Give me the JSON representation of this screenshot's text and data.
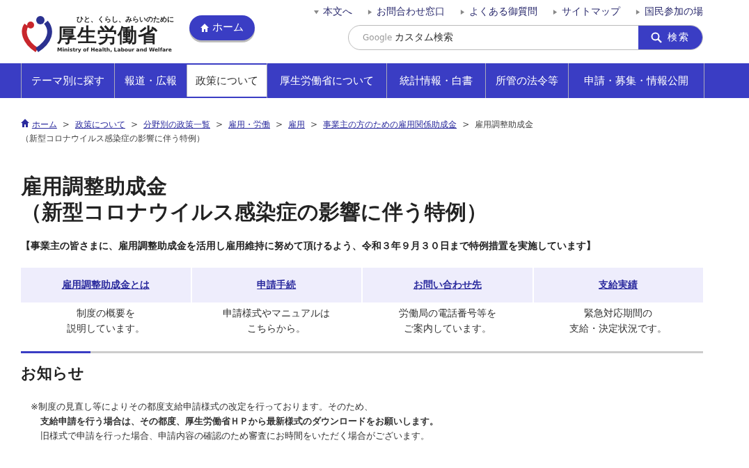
{
  "header": {
    "logo": {
      "tagline": "ひと、くらし、みらいのために",
      "name": "厚生労働省",
      "english": "Ministry of Health, Labour and Welfare"
    },
    "home_button": "ホーム",
    "utility_links": [
      {
        "label": "本文へ",
        "kind": "down"
      },
      {
        "label": "お問合わせ窓口",
        "kind": "right"
      },
      {
        "label": "よくある御質問",
        "kind": "right"
      },
      {
        "label": "サイトマップ",
        "kind": "right"
      },
      {
        "label": "国民参加の場",
        "kind": "right"
      }
    ],
    "search": {
      "brand": "Google",
      "placeholder": "カスタム検索",
      "button": "検索"
    }
  },
  "nav": [
    {
      "label": "テーマ別に探す",
      "selected": false
    },
    {
      "label": "報道・広報",
      "selected": false
    },
    {
      "label": "政策について",
      "selected": true
    },
    {
      "label": "厚生労働省について",
      "selected": false
    },
    {
      "label": "統計情報・白書",
      "selected": false
    },
    {
      "label": "所管の法令等",
      "selected": false
    },
    {
      "label": "申請・募集・情報公開",
      "selected": false
    }
  ],
  "breadcrumb": [
    {
      "label": "ホーム",
      "link": true
    },
    {
      "separator": ">",
      "label": "政策について",
      "link": true
    },
    {
      "separator": ">",
      "label": "分野別の政策一覧",
      "link": true
    },
    {
      "separator": ">",
      "label": "雇用・労働",
      "link": true
    },
    {
      "separator": ">",
      "label": "雇用",
      "link": true
    },
    {
      "separator": ">",
      "label": "事業主の方のための雇用関係助成金",
      "link": true
    },
    {
      "separator": ">",
      "lines": [
        "雇用調整助成金",
        "（新型コロナウイルス感染症の影響に伴う特例）"
      ],
      "link": false
    }
  ],
  "title": [
    "雇用調整助成金",
    "（新型コロナウイルス感染症の影響に伴う特例）"
  ],
  "lead": "【事業主の皆さまに、雇用調整助成金を活用し雇用維持に努めて頂けるよう、令和３年９月３０日まで特例措置を実施しています】",
  "cards": [
    {
      "link": "雇用調整助成金とは",
      "description": [
        "制度の概要を",
        "説明しています。"
      ]
    },
    {
      "link": "申請手続",
      "description": [
        "申請様式やマニュアルは",
        "こちらから。"
      ]
    },
    {
      "link": "お問い合わせ先",
      "description": [
        "労働局の電話番号等を",
        "ご案内しています。"
      ]
    },
    {
      "link": "支給実績",
      "description": [
        "緊急対応期間の",
        "支給・決定状況です。"
      ]
    }
  ],
  "notice": {
    "heading": "お知らせ",
    "lines": [
      {
        "text": "※制度の見直し等によりその都度支給申請様式の改定を行っております。そのため、",
        "bold": false
      },
      {
        "text": "支給申請を行う場合は、その都度、厚生労働省ＨＰから最新様式のダウンロードをお願いします。",
        "bold": true
      },
      {
        "text": "旧様式で申請を行った場合、申請内容の確認のため審査にお時間をいただく場合がございます。",
        "bold": false
      }
    ]
  }
}
